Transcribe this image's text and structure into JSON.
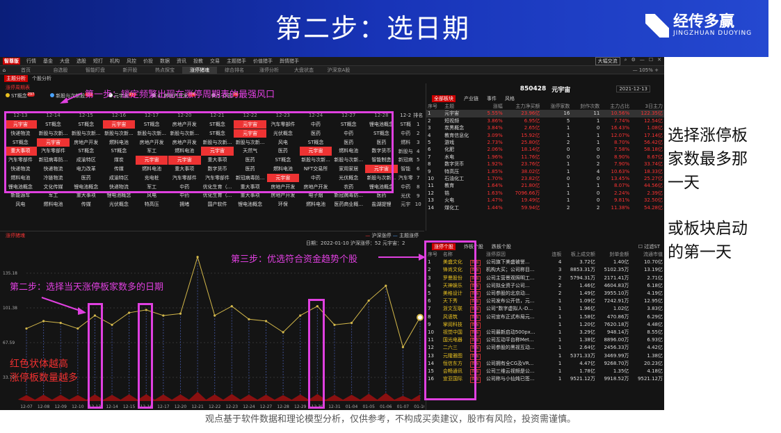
{
  "banner": {
    "title": "第二步：选日期",
    "logo_cn": "经传多赢",
    "logo_en": "JINGZHUAN DUOYING"
  },
  "app": {
    "brand": "智尊版",
    "menu": [
      "行情",
      "基金",
      "大盘",
      "选股",
      "短打",
      "机构",
      "风控",
      "价投",
      "数据",
      "资讯",
      "投教",
      "交易",
      "主题猎手",
      "价值猎手",
      "舆情猎手"
    ],
    "window_tab": "大幅交流",
    "tabs": [
      "首页",
      "自选股",
      "智能盯盘",
      "新开股",
      "热点探宝",
      "涨停猪魂",
      "综合排名",
      "涨停分析",
      "大盘状态",
      "沪深京A股"
    ],
    "active_tab": "涨停猪魂",
    "zoom": "105%",
    "subtabs": [
      "主题分析",
      "个股分析"
    ]
  },
  "cycle": {
    "title": "涨停周期表",
    "legend": [
      {
        "label": "ST概念",
        "count": "297",
        "color": "#e8c020"
      },
      {
        "label": "新股与次新股",
        "count": "153",
        "color": "#4aa3ff"
      },
      {
        "label": "元宇宙",
        "count": "151",
        "color": "#f0f0f0"
      },
      {
        "label": "4. 房地产开发",
        "count": "100",
        "color": "#aaa"
      },
      {
        "label": "5. 中药",
        "count": "79",
        "color": "#aaa"
      }
    ],
    "dates": [
      "12-13",
      "12-14",
      "12-15",
      "12-16",
      "12-17",
      "12-20",
      "12-21",
      "12-22",
      "12-23",
      "12-24",
      "12-27",
      "12-28",
      "12-2"
    ],
    "rank_label": "排名",
    "rows": [
      {
        "cells": [
          "元宇宙",
          "ST概念",
          "ST概念",
          "元宇宙",
          "ST概念",
          "房地产开发",
          "ST概念",
          "元宇宙",
          "汽车零部件",
          "中药",
          "ST概念",
          "锂电池概念"
        ],
        "hl": [
          0,
          3,
          7
        ],
        "last": "ST概",
        "num": "1"
      },
      {
        "cells": [
          "快递物流",
          "新股与次新...",
          "新股与次新...",
          "新股与次新...",
          "新股与次新...",
          "新股与次新...",
          "ST概念",
          "元宇宙",
          "光伏概念",
          "医药",
          "中药",
          "ST概念"
        ],
        "hl": [
          7
        ],
        "last": "中药",
        "num": "2"
      },
      {
        "cells": [
          "ST概念",
          "元宇宙",
          "房地产开发",
          "燃料电池",
          "房地产开发",
          "房地产开发",
          "新股与次新...",
          "新股与次新...",
          "风电",
          "ST概念",
          "医药",
          "医药"
        ],
        "hl": [
          1
        ],
        "last": "燃料",
        "num": "3"
      },
      {
        "cells": [
          "重大事项",
          "汽车零部件",
          "ST概念",
          "ST概念",
          "军工",
          "燃料电池",
          "元宇宙",
          "天然气",
          "医药",
          "元宇宙",
          "燃料电池",
          "数字货币"
        ],
        "hl": [
          0,
          6,
          9
        ],
        "last": "新股与",
        "num": "4"
      },
      {
        "cells": [
          "汽车零部件",
          "新冠病毒防...",
          "成渝特区",
          "煤炭",
          "元宇宙",
          "元宇宙",
          "重大事项",
          "医药",
          "ST概念",
          "新股与次新...",
          "新股与次新...",
          "智能制造"
        ],
        "hl": [
          4,
          5
        ],
        "last": "新冠病",
        "num": "5"
      },
      {
        "cells": [
          "快递物流",
          "快递物流",
          "电力改革",
          "传媒",
          "燃料电池",
          "重大事项",
          "数字货币",
          "医药",
          "燃料电池",
          "NFT交易所",
          "家用家居",
          "元宇宙"
        ],
        "hl": [
          11
        ],
        "last": "智能",
        "num": "6"
      },
      {
        "cells": [
          "燃料电池",
          "冷链物流",
          "医药",
          "成渝特区",
          "充电桩",
          "汽车零部件",
          "汽车零部件",
          "新冠病毒防...",
          "元宇宙",
          "中药",
          "光伏概念",
          "新股与次新..."
        ],
        "hl": [
          8
        ],
        "last": "汽车零",
        "num": "7"
      },
      {
        "cells": [
          "锂电池概念",
          "文化传媒",
          "锂电池概念",
          "快递物流",
          "军工",
          "中药",
          "优化生育（...",
          "重大事项",
          "房地产开发",
          "房地产开发",
          "农药",
          "锂电池概念"
        ],
        "hl": [],
        "last": "中药",
        "num": "8"
      },
      {
        "cells": [
          "新能源车",
          "军工",
          "重大事项",
          "锂电池概念",
          "风电",
          "中药",
          "优化生育（...",
          "重大事项",
          "房地产开发",
          "电子烟",
          "新冠病毒防...",
          "医药"
        ],
        "hl": [],
        "last": "光伏",
        "num": "9"
      },
      {
        "cells": [
          "风电",
          "燃料电池",
          "传媒",
          "光伏概念",
          "特高压",
          "拥堵",
          "国产软件",
          "锂电池概念",
          "环保",
          "燃料电池",
          "医药商业概...",
          "盐湖提锂"
        ],
        "hl": [],
        "last": "元宇",
        "num": "10"
      }
    ]
  },
  "sector": {
    "code": "850428",
    "name": "元宇宙",
    "date": "2021-12-13",
    "tabs": [
      "全部板块",
      "产业链",
      "事件",
      "风格"
    ],
    "columns": [
      "序号",
      "主题",
      "涨幅",
      "主力净买额",
      "涨停家数",
      "封作次数",
      "主力占比",
      "3日主力"
    ],
    "rows": [
      [
        "1",
        "元宇宙",
        "5.55%",
        "23.96亿",
        "16",
        "11",
        "10.56%",
        "122.35亿"
      ],
      [
        "2",
        "短视频",
        "3.86%",
        "6.95亿",
        "5",
        "1",
        "7.74%",
        "12.54亿"
      ],
      [
        "3",
        "炭黑概念",
        "3.84%",
        "2.65亿",
        "1",
        "0",
        "16.43%",
        "1.08亿"
      ],
      [
        "4",
        "教育信息化",
        "3.09%",
        "15.92亿",
        "1",
        "1",
        "12.07%",
        "17.14亿"
      ],
      [
        "5",
        "游戏",
        "2.73%",
        "25.80亿",
        "2",
        "1",
        "8.70%",
        "56.42亿"
      ],
      [
        "6",
        "化肥",
        "2.06%",
        "18.14亿",
        "0",
        "0",
        "7.58%",
        "58.18亿"
      ],
      [
        "7",
        "水电",
        "1.96%",
        "11.76亿",
        "0",
        "0",
        "8.90%",
        "8.67亿"
      ],
      [
        "8",
        "数字货币",
        "1.92%",
        "23.76亿",
        "1",
        "2",
        "7.90%",
        "33.74亿"
      ],
      [
        "9",
        "特高压",
        "1.85%",
        "38.02亿",
        "1",
        "4",
        "10.63%",
        "18.33亿"
      ],
      [
        "10",
        "石油化工",
        "1.70%",
        "23.82亿",
        "0",
        "0",
        "13.45%",
        "25.27亿"
      ],
      [
        "11",
        "教育",
        "1.64%",
        "21.80亿",
        "1",
        "1",
        "8.07%",
        "44.56亿"
      ],
      [
        "12",
        "锆",
        "1.63%",
        "7096.66万",
        "1",
        "0",
        "2.24%",
        "2.39亿"
      ],
      [
        "13",
        "火电",
        "1.47%",
        "19.49亿",
        "1",
        "0",
        "9.81%",
        "32.50亿"
      ],
      [
        "14",
        "煤化工",
        "1.44%",
        "59.94亿",
        "2",
        "2",
        "11.38%",
        "54.28亿"
      ]
    ]
  },
  "chart": {
    "title": "涨停猪魂",
    "legend": [
      "沪深涨停",
      "主题涨停"
    ],
    "info": "日期：2022-01-10    沪深涨停：52    元宇宙：2",
    "ylabels": [
      "135.18",
      "101.38",
      "67.59",
      "33.79"
    ]
  },
  "chart_data": {
    "type": "line",
    "x": [
      "12-07",
      "12-08",
      "12-09",
      "12-10",
      "12-13",
      "12-14",
      "12-15",
      "12-16",
      "12-17",
      "12-20",
      "12-21",
      "12-22",
      "12-23",
      "12-24",
      "12-27",
      "12-28",
      "12-29",
      "12-30",
      "12-31",
      "01-04",
      "01-05",
      "01-06",
      "01-07",
      "01-10"
    ],
    "series": [
      {
        "name": "沪深涨停",
        "values": [
          78,
          86,
          84,
          78,
          92,
          82,
          95,
          98,
          92,
          94,
          155,
          92,
          102,
          88,
          86,
          74,
          92,
          102,
          82,
          84,
          108,
          124,
          58,
          90
        ]
      }
    ],
    "ylim": [
      0,
      160
    ]
  },
  "stocks": {
    "tabs": [
      "涨停个股",
      "炸板个股",
      "跌板个股"
    ],
    "filter": "过滤ST",
    "columns": [
      "序号",
      "名称",
      "",
      "涨停原因",
      "连板",
      "板上成交额",
      "封单金额",
      "流通市值"
    ],
    "rows": [
      [
        "1",
        "美盛文化",
        "公司旗下美盛被誉...",
        "4",
        "3.72亿",
        "1.40亿",
        "10.70亿"
      ],
      [
        "2",
        "锋尚文化",
        "机构大买；公司称目...",
        "3",
        "8853.31万",
        "5102.35万",
        "13.19亿"
      ],
      [
        "3",
        "罗曼股份",
        "公司主营景观照明工...",
        "2",
        "5794.31万",
        "2171.41万",
        "2.71亿"
      ],
      [
        "4",
        "天神娱乐",
        "公司拟全资子公司...",
        "2",
        "1.46亿",
        "4604.83万",
        "6.18亿"
      ],
      [
        "5",
        "美格设计",
        "公司参股的北京动...",
        "2",
        "1.49亿",
        "3955.10万",
        "4.19亿"
      ],
      [
        "6",
        "天下秀",
        "公司发布公开信，元...",
        "1",
        "1.09亿",
        "7242.91万",
        "12.95亿"
      ],
      [
        "7",
        "浙文互联",
        "公司“数字虚拟人-D...",
        "1",
        "1.96亿",
        "1.02亿",
        "3.83亿"
      ],
      [
        "8",
        "风语筑",
        "公司宣布正式布局元...",
        "1",
        "1.58亿",
        "470.86万",
        "6.29亿"
      ],
      [
        "9",
        "掌阅科技",
        "",
        "1",
        "1.20亿",
        "7620.18万",
        "4.48亿"
      ],
      [
        "10",
        "视觉中国",
        "公司最新启动500px...",
        "1",
        "3.29亿",
        "948.14万",
        "8.55亿"
      ],
      [
        "11",
        "国光电器",
        "公司互动平台称Met...",
        "1",
        "1.38亿",
        "8896.00万",
        "6.93亿"
      ],
      [
        "12",
        "二六三",
        "公司参股的黑视互动...",
        "1",
        "2.64亿",
        "2456.33万",
        "4.42亿"
      ],
      [
        "13",
        "元隆雅图",
        "",
        "1",
        "5371.33万",
        "3469.99万",
        "1.38亿"
      ],
      [
        "14",
        "恒信东方",
        "公司拥有全CG及VR...",
        "1",
        "4.47亿",
        "9268.70万",
        "20.23亿"
      ],
      [
        "15",
        "会畅通讯",
        "公司三维云视频是公...",
        "1",
        "1.78亿",
        "1.35亿",
        "4.18亿"
      ],
      [
        "16",
        "宣亚国际",
        "公司称与小仙炖已签...",
        "1",
        "9521.12万",
        "9918.52万",
        "9521.12万"
      ]
    ],
    "tag": "首板"
  },
  "annotations": {
    "step1": "第一步：锁定频繁出现在涨停周期表的最强风口",
    "step2": "第二步：选择当天涨停板家数多的日期",
    "step3": "第三步：优选符合资金趋势个股",
    "red_note1": "红色状体越高",
    "red_note2": "涨停板数量越多"
  },
  "right_note": {
    "line1": "选择涨停板",
    "line2": "家数最多那",
    "line3": "一天",
    "line4": "或板块启动",
    "line5": "的第一天"
  },
  "disclaimer": "观点基于软件数据和理论模型分析，仅供参考，不构成买卖建议，股市有风险，投资需谨慎。",
  "colors": {
    "accent": "#e33",
    "annotation": "#e040e0",
    "banner": "#1834b8"
  }
}
